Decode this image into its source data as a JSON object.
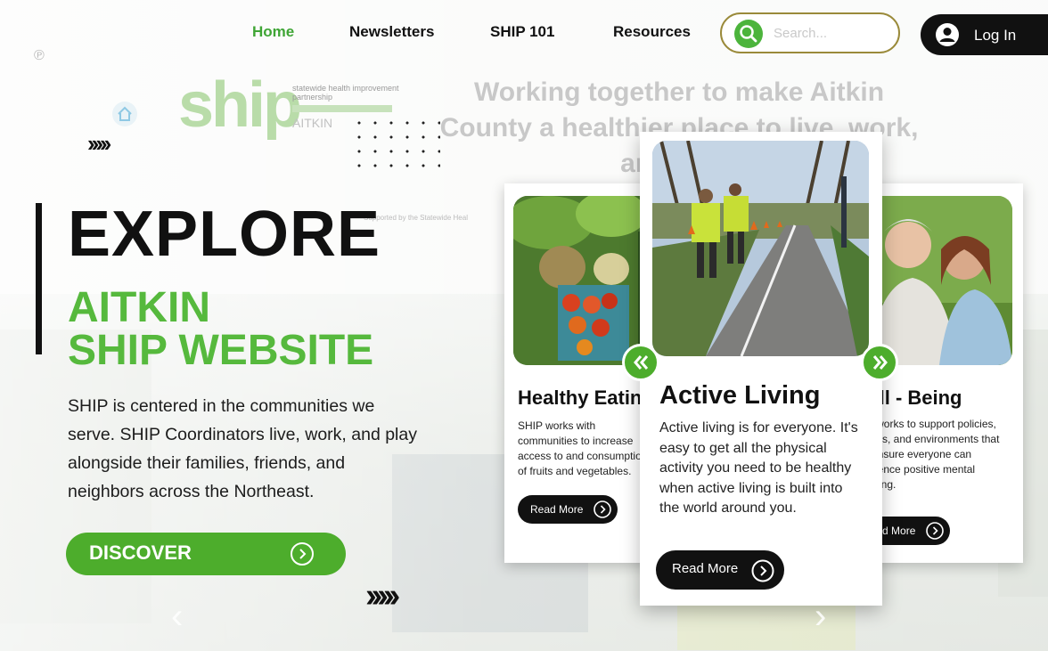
{
  "nav": {
    "items": [
      {
        "label": "Home",
        "active": true
      },
      {
        "label": "Newsletters",
        "active": false
      },
      {
        "label": "SHIP 101",
        "active": false
      },
      {
        "label": "Resources",
        "active": false
      }
    ],
    "search_placeholder": "Search...",
    "login_label": "Log In"
  },
  "header": {
    "logo_text": "ship",
    "logo_sub": "statewide health improvement partnership",
    "logo_county": "AITKIN",
    "tagline": "Working together to make Aitkin County a healthier place to live, work, and play!",
    "supported_text": "Supported by the Statewide Heal"
  },
  "hero": {
    "arrows": "›››››",
    "title": "EXPLORE",
    "subtitle_line1": "AITKIN",
    "subtitle_line2": "SHIP WEBSITE",
    "intro": "SHIP is centered in the communities we serve. SHIP Coordinators live, work, and play alongside their families, friends, and neighbors across the Northeast.",
    "discover_label": "DISCOVER",
    "arrows_bottom": "›››››"
  },
  "cards": [
    {
      "title": "Healthy Eating",
      "text": "SHIP works with communities to increase access to and consumption of fruits and vegetables.",
      "button": "Read More"
    },
    {
      "title": "Active Living",
      "text": "Active living is for everyone. It's easy to get all the physical activity you need to be healthy when active living is built into the world around you.",
      "button": "Read More"
    },
    {
      "title": "Well - Being",
      "text": "SHIP works to support policies, systems, and environments that help ensure everyone can experience positive mental wellbeing.",
      "button": "Read More"
    }
  ],
  "colors": {
    "accent_green": "#4dad2c",
    "nav_active": "#3fa535",
    "dark": "#111111"
  },
  "icons": {
    "search": "search-icon",
    "user": "user-icon",
    "prev": "double-chevron-left-icon",
    "next": "double-chevron-right-icon"
  }
}
